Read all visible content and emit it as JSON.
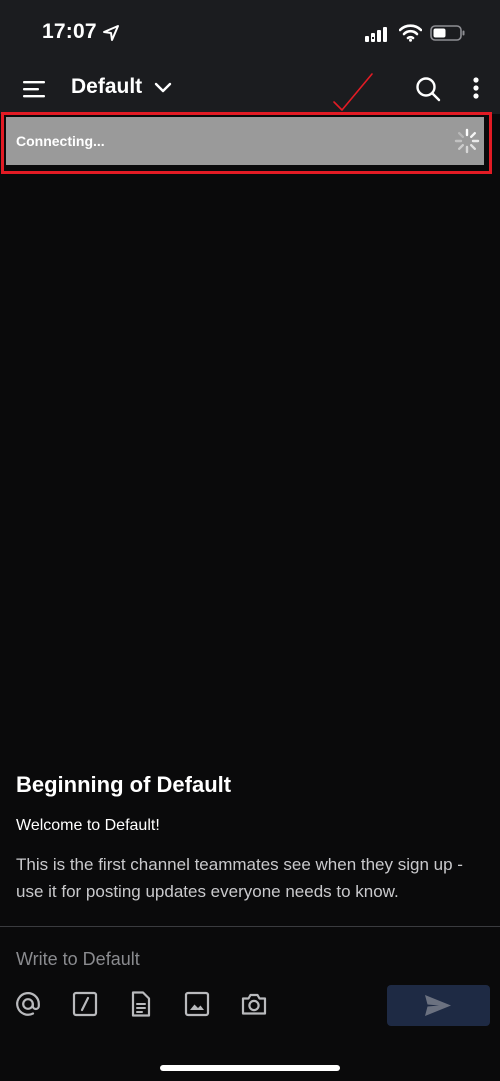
{
  "status_bar": {
    "time": "17:07"
  },
  "header": {
    "channel_title": "Default"
  },
  "banner": {
    "text": "Connecting..."
  },
  "intro": {
    "title": "Beginning of Default",
    "welcome": "Welcome to Default!",
    "description": "This is the first channel teammates see when they sign up - use it for posting updates everyone needs to know."
  },
  "composer": {
    "placeholder": "Write to Default",
    "value": ""
  },
  "icons": {
    "status": [
      "location-arrow-icon",
      "cellular-signal-icon",
      "wifi-icon",
      "battery-icon"
    ],
    "header": [
      "menu-icon",
      "chevron-down-icon",
      "search-icon",
      "more-vertical-icon"
    ],
    "banner": [
      "spinner-icon"
    ],
    "composer": [
      "at-mention-icon",
      "slash-command-icon",
      "file-attachment-icon",
      "image-icon",
      "camera-icon",
      "send-icon"
    ]
  },
  "colors": {
    "background": "#0a0a0b",
    "header_background": "#1b1c1f",
    "banner_background": "#9a9a9a",
    "highlight_border": "#e21b24",
    "send_button_background": "#1e2a44"
  }
}
